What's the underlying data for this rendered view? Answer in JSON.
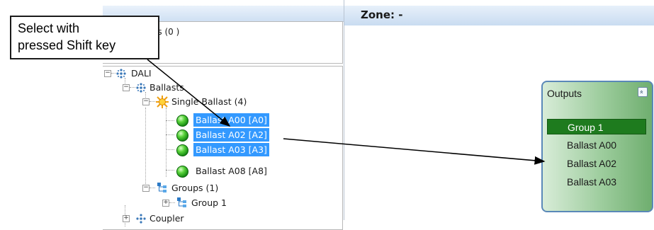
{
  "callout": {
    "line1": "Select with",
    "line2": "pressed Shift key"
  },
  "top_box": {
    "text": "es (0 )"
  },
  "tree": {
    "dali": "DALI",
    "ballasts": "Ballasts",
    "single_ballast": "Single Ballast (4)",
    "items": [
      {
        "label": "Ballast A00 [A0]",
        "selected": true
      },
      {
        "label": "Ballast A02 [A2]",
        "selected": true
      },
      {
        "label": "Ballast A03 [A3]",
        "selected": true
      },
      {
        "label": "Ballast A08 [A8]",
        "selected": false
      }
    ],
    "groups": "Groups (1)",
    "group1": "Group 1",
    "coupler": "Coupler"
  },
  "zone": {
    "title": "Zone: -"
  },
  "outputs": {
    "title": "Outputs",
    "collapse_glyph": "»",
    "items": [
      "Group 1",
      "Ballast A00",
      "Ballast A02",
      "Ballast A03"
    ]
  },
  "colors": {
    "selection": "#3399ff",
    "group_highlight": "#1e7b1e",
    "header_blue": "#c9dcf1"
  },
  "icons": {
    "expander": "⊟",
    "collapsed_expander": "⊞"
  }
}
